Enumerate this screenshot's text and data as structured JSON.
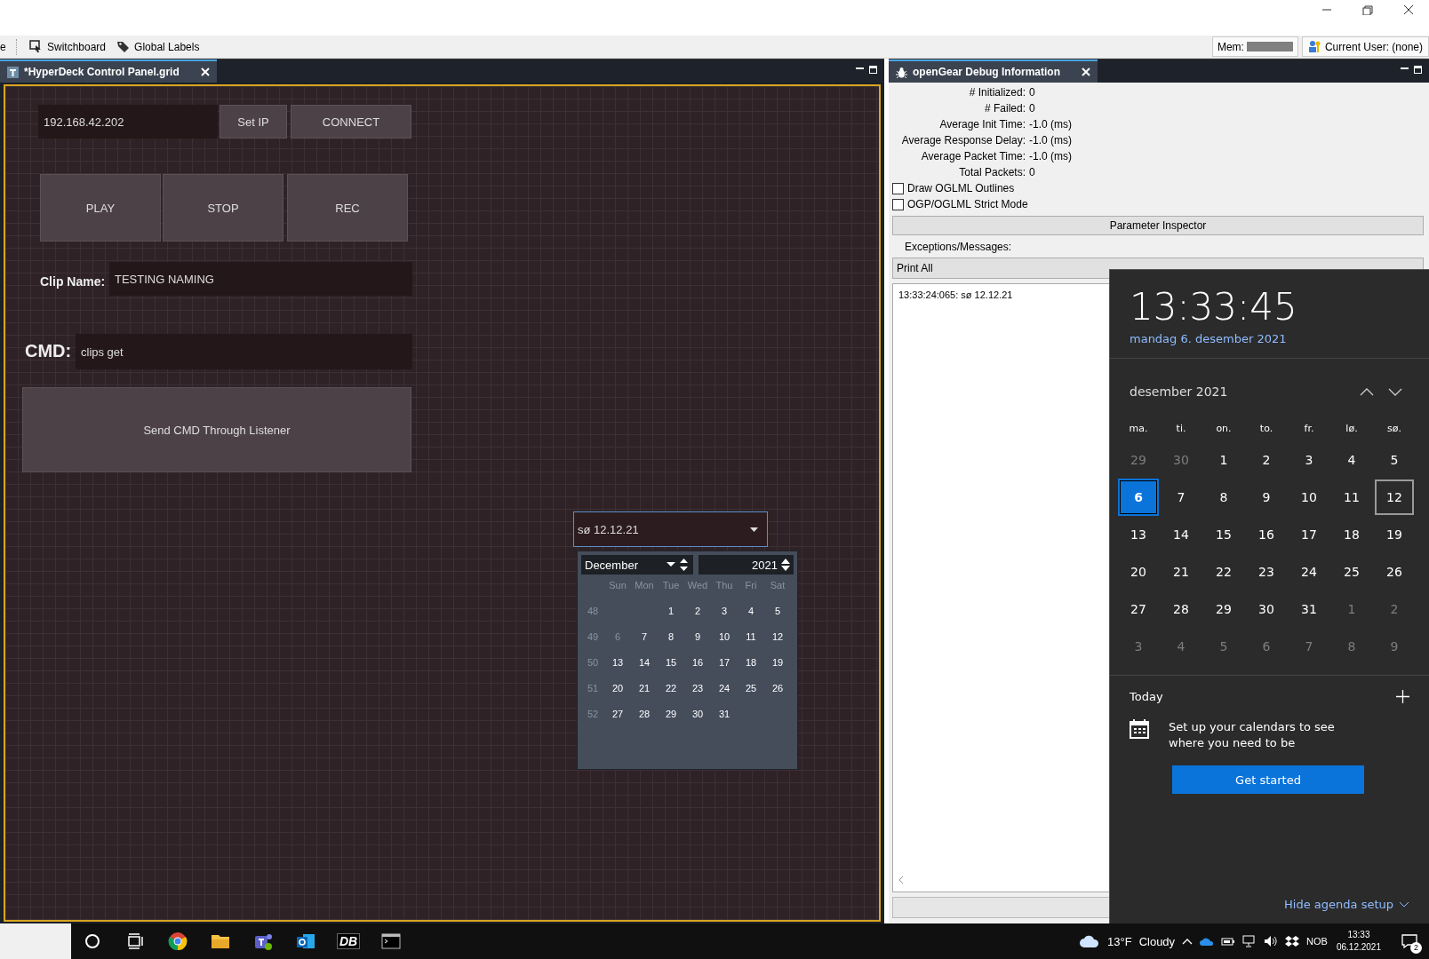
{
  "toolbar": {
    "cut_item": "e",
    "items": [
      {
        "label": "Switchboard",
        "kind": "switchboard"
      },
      {
        "label": "Global Labels",
        "kind": "tag"
      }
    ],
    "mem_label": "Mem:",
    "user": "Current User: (none)"
  },
  "editor_tab": {
    "title": "*HyperDeck Control Panel.grid",
    "selected": true
  },
  "canvas": {
    "ip_field": "192.168.42.202",
    "buttons": [
      {
        "label": "Set IP",
        "kind": "small"
      },
      {
        "label": "CONNECT",
        "kind": "small"
      },
      {
        "label": "PLAY",
        "kind": "large"
      },
      {
        "label": "STOP",
        "kind": "large"
      },
      {
        "label": "REC",
        "kind": "large"
      },
      {
        "label": "Send CMD Through Listener",
        "kind": "wide"
      }
    ],
    "clip_name": {
      "label": "Clip Name:",
      "value": "TESTING NAMING"
    },
    "cmd": {
      "label": "CMD:",
      "value": "clips get"
    },
    "date_combo": "sø 12.12.21",
    "date_popup": {
      "month": "December",
      "year": "2021",
      "weekdays": [
        "Sun",
        "Mon",
        "Tue",
        "Wed",
        "Thu",
        "Fri",
        "Sat"
      ],
      "weeks": [
        {
          "week": "48",
          "days": [
            {
              "day": "1",
              "muted": false
            },
            {
              "day": "2",
              "muted": false
            },
            {
              "day": "3",
              "muted": false
            },
            {
              "day": "4",
              "muted": false
            },
            {
              "day": "5",
              "muted": false
            }
          ]
        },
        {
          "week": "49",
          "days": [
            {
              "day": "6",
              "muted": true
            },
            {
              "day": "7",
              "muted": false
            },
            {
              "day": "8",
              "muted": false
            },
            {
              "day": "9",
              "muted": false
            },
            {
              "day": "10",
              "muted": false
            },
            {
              "day": "11",
              "muted": false
            },
            {
              "day": "12",
              "muted": false
            }
          ]
        },
        {
          "week": "50",
          "days": [
            {
              "day": "13",
              "muted": false
            },
            {
              "day": "14",
              "muted": false
            },
            {
              "day": "15",
              "muted": false
            },
            {
              "day": "16",
              "muted": false
            },
            {
              "day": "17",
              "muted": false
            },
            {
              "day": "18",
              "muted": false
            },
            {
              "day": "19",
              "muted": false
            }
          ]
        },
        {
          "week": "51",
          "days": [
            {
              "day": "20",
              "muted": false
            },
            {
              "day": "21",
              "muted": false
            },
            {
              "day": "22",
              "muted": false
            },
            {
              "day": "23",
              "muted": false
            },
            {
              "day": "24",
              "muted": false
            },
            {
              "day": "25",
              "muted": false
            },
            {
              "day": "26",
              "muted": false
            }
          ]
        },
        {
          "week": "52",
          "days": [
            {
              "day": "27",
              "muted": false
            },
            {
              "day": "28",
              "muted": false
            },
            {
              "day": "29",
              "muted": false
            },
            {
              "day": "30",
              "muted": false
            },
            {
              "day": "31",
              "muted": false
            }
          ]
        }
      ]
    }
  },
  "debug_panel": {
    "tab": {
      "title": "openGear Debug Information",
      "selected": true
    },
    "stats": [
      {
        "label": "# Initialized:",
        "value": "0"
      },
      {
        "label": "# Failed:",
        "value": "0"
      },
      {
        "label": "Average Init Time:",
        "value": "-1.0 (ms)"
      },
      {
        "label": "Average Response Delay:",
        "value": "-1.0 (ms)"
      },
      {
        "label": "Average Packet Time:",
        "value": "-1.0 (ms)"
      },
      {
        "label": "Total Packets:",
        "value": "0"
      }
    ],
    "options": [
      {
        "label": "Draw OGLML Outlines",
        "checked": false
      },
      {
        "label": "OGP/OGLML Strict Mode",
        "checked": false
      }
    ],
    "inspector_button": "Parameter Inspector",
    "messages_label": "Exceptions/Messages:",
    "filter": "Print All",
    "log": [
      "13:33:24:065: sø 12.12.21"
    ]
  },
  "clock_flyout": {
    "time": "13:33:45",
    "date": "mandag 6. desember 2021",
    "month": "desember 2021",
    "weekdays": [
      "ma.",
      "ti.",
      "on.",
      "to.",
      "fr.",
      "lø.",
      "sø."
    ],
    "days": [
      {
        "day": "29",
        "kind": "adjacent",
        "today": false,
        "selected": false
      },
      {
        "day": "30",
        "kind": "adjacent",
        "today": false,
        "selected": false
      },
      {
        "day": "1",
        "kind": "current",
        "today": false,
        "selected": false
      },
      {
        "day": "2",
        "kind": "current",
        "today": false,
        "selected": false
      },
      {
        "day": "3",
        "kind": "current",
        "today": false,
        "selected": false
      },
      {
        "day": "4",
        "kind": "current",
        "today": false,
        "selected": false
      },
      {
        "day": "5",
        "kind": "current",
        "today": false,
        "selected": false
      },
      {
        "day": "6",
        "kind": "current",
        "today": true,
        "selected": false
      },
      {
        "day": "7",
        "kind": "current",
        "today": false,
        "selected": false
      },
      {
        "day": "8",
        "kind": "current",
        "today": false,
        "selected": false
      },
      {
        "day": "9",
        "kind": "current",
        "today": false,
        "selected": false
      },
      {
        "day": "10",
        "kind": "current",
        "today": false,
        "selected": false
      },
      {
        "day": "11",
        "kind": "current",
        "today": false,
        "selected": false
      },
      {
        "day": "12",
        "kind": "current",
        "today": false,
        "selected": true
      },
      {
        "day": "13",
        "kind": "current",
        "today": false,
        "selected": false
      },
      {
        "day": "14",
        "kind": "current",
        "today": false,
        "selected": false
      },
      {
        "day": "15",
        "kind": "current",
        "today": false,
        "selected": false
      },
      {
        "day": "16",
        "kind": "current",
        "today": false,
        "selected": false
      },
      {
        "day": "17",
        "kind": "current",
        "today": false,
        "selected": false
      },
      {
        "day": "18",
        "kind": "current",
        "today": false,
        "selected": false
      },
      {
        "day": "19",
        "kind": "current",
        "today": false,
        "selected": false
      },
      {
        "day": "20",
        "kind": "current",
        "today": false,
        "selected": false
      },
      {
        "day": "21",
        "kind": "current",
        "today": false,
        "selected": false
      },
      {
        "day": "22",
        "kind": "current",
        "today": false,
        "selected": false
      },
      {
        "day": "23",
        "kind": "current",
        "today": false,
        "selected": false
      },
      {
        "day": "24",
        "kind": "current",
        "today": false,
        "selected": false
      },
      {
        "day": "25",
        "kind": "current",
        "today": false,
        "selected": false
      },
      {
        "day": "26",
        "kind": "current",
        "today": false,
        "selected": false
      },
      {
        "day": "27",
        "kind": "current",
        "today": false,
        "selected": false
      },
      {
        "day": "28",
        "kind": "current",
        "today": false,
        "selected": false
      },
      {
        "day": "29",
        "kind": "current",
        "today": false,
        "selected": false
      },
      {
        "day": "30",
        "kind": "current",
        "today": false,
        "selected": false
      },
      {
        "day": "31",
        "kind": "current",
        "today": false,
        "selected": false
      },
      {
        "day": "1",
        "kind": "adjacent",
        "today": false,
        "selected": false
      },
      {
        "day": "2",
        "kind": "adjacent",
        "today": false,
        "selected": false
      },
      {
        "day": "3",
        "kind": "adjacent",
        "today": false,
        "selected": false
      },
      {
        "day": "4",
        "kind": "adjacent",
        "today": false,
        "selected": false
      },
      {
        "day": "5",
        "kind": "adjacent",
        "today": false,
        "selected": false
      },
      {
        "day": "6",
        "kind": "adjacent",
        "today": false,
        "selected": false
      },
      {
        "day": "7",
        "kind": "adjacent",
        "today": false,
        "selected": false
      },
      {
        "day": "8",
        "kind": "adjacent",
        "today": false,
        "selected": false
      },
      {
        "day": "9",
        "kind": "adjacent",
        "today": false,
        "selected": false
      }
    ],
    "agenda": {
      "title": "Today",
      "message": "Set up your calendars to see where you need to be",
      "button": "Get started",
      "hide_link": "Hide agenda setup"
    }
  },
  "taskbar": {
    "db_logo": "DB",
    "temperature": "13°F",
    "condition": "Cloudy",
    "language": "NOB",
    "time": "13:33",
    "date": "06.12.2021",
    "notifications": "2"
  }
}
